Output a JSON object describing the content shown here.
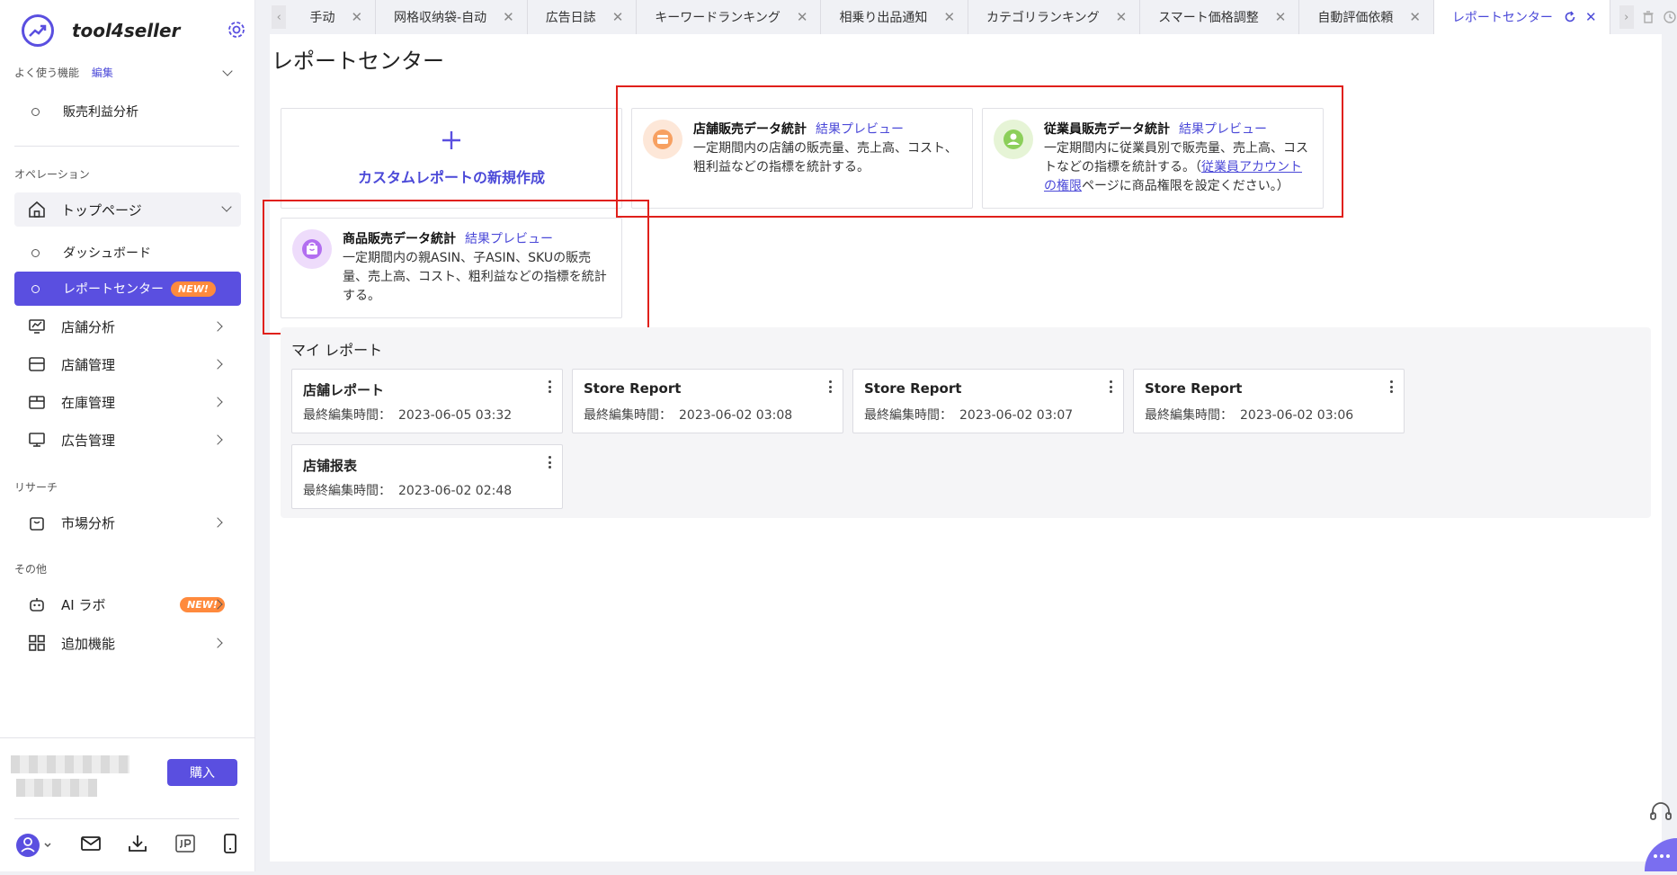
{
  "app": {
    "name": "tool4seller"
  },
  "sidebar": {
    "favorites_label": "よく使う機能",
    "favorites_edit": "編集",
    "favorite_items": [
      "販売利益分析"
    ],
    "operation_label": "オペレーション",
    "top_page": "トップページ",
    "top_children": [
      "ダッシュボード",
      "レポートセンター"
    ],
    "new_badge": "NEW!",
    "operation_items": [
      "店舗分析",
      "店舗管理",
      "在庫管理",
      "広告管理"
    ],
    "research_label": "リサーチ",
    "research_items": [
      "市場分析"
    ],
    "other_label": "その他",
    "other_items": [
      "AI ラボ",
      "追加機能"
    ],
    "buy_button": "購入"
  },
  "tabs": [
    {
      "label": "手动",
      "active": false
    },
    {
      "label": "网格収纳袋-自动",
      "active": false
    },
    {
      "label": "広告日誌",
      "active": false
    },
    {
      "label": "キーワードランキング",
      "active": false
    },
    {
      "label": "相乗り出品通知",
      "active": false
    },
    {
      "label": "カテゴリランキング",
      "active": false
    },
    {
      "label": "スマート価格調整",
      "active": false
    },
    {
      "label": "自動評価依頼",
      "active": false
    },
    {
      "label": "レポートセンター",
      "active": true
    }
  ],
  "page": {
    "title": "レポートセンター",
    "create_custom": "カスタムレポートの新規作成",
    "preview_link": "結果プレビュー",
    "templates": [
      {
        "title": "店舗販売データ統計",
        "desc": "一定期間内の店舗の販売量、売上高、コスト、粗利益などの指標を統計する。",
        "color": "#f7a061"
      },
      {
        "title": "従業員販売データ統計",
        "desc_before": "一定期間内に従業員別で販売量、売上高、コストなどの指標を統計する。（",
        "desc_link": "従業員アカウントの権限",
        "desc_after": "ページに商品権限を設定ください。）",
        "color": "#8ccf5a"
      },
      {
        "title": "商品販売データ統計",
        "desc": "一定期間内の親ASIN、子ASIN、SKUの販売量、売上高、コスト、粗利益などの指標を統計する。",
        "color": "#b26ef0"
      }
    ],
    "my_reports_title": "マイ レポート",
    "edit_time_label": "最終編集時間：",
    "reports": [
      {
        "name": "店舗レポート",
        "time": "2023-06-05 03:32"
      },
      {
        "name": "Store Report",
        "time": "2023-06-02 03:08"
      },
      {
        "name": "Store Report",
        "time": "2023-06-02 03:07"
      },
      {
        "name": "Store Report",
        "time": "2023-06-02 03:06"
      },
      {
        "name": "店铺报表",
        "time": "2023-06-02 02:48"
      }
    ]
  },
  "colors": {
    "accent": "#5a4fe0",
    "link": "#4b49d8",
    "new_badge": "#ff8a3d",
    "highlight": "#e0201b"
  }
}
